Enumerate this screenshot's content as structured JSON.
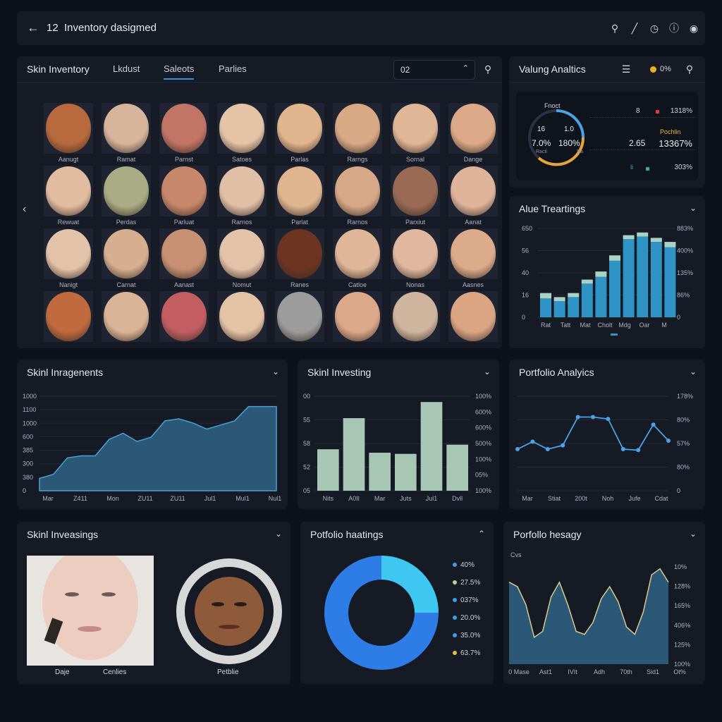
{
  "header": {
    "title": "12  Inventory dasigmed"
  },
  "skin_inventory": {
    "title": "Skin Inventory",
    "tabs": [
      "Lkdust",
      "Saleots",
      "Parlies"
    ],
    "search_value": "02",
    "faces": [
      {
        "label": "Aanugt",
        "color": "#b86a3e"
      },
      {
        "label": "Ramat",
        "color": "#d7b49c"
      },
      {
        "label": "Parnst",
        "color": "#c27466"
      },
      {
        "label": "Satoes",
        "color": "#e4c3a6"
      },
      {
        "label": "Parlas",
        "color": "#e1b58e"
      },
      {
        "label": "Rarngs",
        "color": "#d9a986"
      },
      {
        "label": "Sornal",
        "color": "#e0b796"
      },
      {
        "label": "Dange",
        "color": "#dcaa88"
      },
      {
        "label": "Rewuat",
        "color": "#e2bca0"
      },
      {
        "label": "Perdas",
        "color": "#a9ac84"
      },
      {
        "label": "Parluat",
        "color": "#c7876a"
      },
      {
        "label": "Rarnos",
        "color": "#e1bfa6"
      },
      {
        "label": "Parlat",
        "color": "#dfb590"
      },
      {
        "label": "Rarnos",
        "color": "#d7a888"
      },
      {
        "label": "Parxiut",
        "color": "#9a6a55"
      },
      {
        "label": "Aanat",
        "color": "#e0b49a"
      },
      {
        "label": "Nanigt",
        "color": "#e2c2a8"
      },
      {
        "label": "Carnat",
        "color": "#d6ae90"
      },
      {
        "label": "Aanast",
        "color": "#c79072"
      },
      {
        "label": "Nomut",
        "color": "#e2c2a8"
      },
      {
        "label": "Ranes",
        "color": "#6e3422"
      },
      {
        "label": "Catloe",
        "color": "#dfb698"
      },
      {
        "label": "Nonas",
        "color": "#e0b8a0"
      },
      {
        "label": "Aasnes",
        "color": "#dcab8c"
      },
      {
        "label": "",
        "color": "#c06a3e"
      },
      {
        "label": "",
        "color": "#d9b496"
      },
      {
        "label": "",
        "color": "#c25e62"
      },
      {
        "label": "",
        "color": "#e4c2a6"
      },
      {
        "label": "",
        "color": "#9c9c9c"
      },
      {
        "label": "",
        "color": "#dba888"
      },
      {
        "label": "",
        "color": "#cfb59e"
      },
      {
        "label": "",
        "color": "#dba584"
      }
    ]
  },
  "valuing": {
    "title": "Valung Analtics",
    "status_text": "0%",
    "gauge": {
      "top": "Fnoct",
      "left_top": "16",
      "left_val": "7.0%",
      "left_sub": "Racti",
      "right_top": "1.0",
      "right_val": "180%",
      "right_sub": "Ra"
    },
    "rows": [
      {
        "a": "8",
        "b": "1318%"
      },
      {
        "a": "Pochlin",
        "b": ""
      },
      {
        "a": "2.65",
        "b": "13367%"
      },
      {
        "a": "li",
        "b": "303%"
      }
    ]
  },
  "alue": {
    "title": "Alue Treartings",
    "chart_data": {
      "type": "bar",
      "categories": [
        "Rat",
        "Tatt",
        "Mat",
        "Cholt",
        "Mdg",
        "Oar",
        "M"
      ],
      "series": [
        {
          "name": "",
          "values": [
            14,
            12,
            15,
            25,
            30,
            42,
            58,
            60,
            56,
            52
          ]
        },
        {
          "name": "",
          "values": [
            4,
            3,
            3,
            3,
            4,
            4,
            3,
            3,
            3,
            4
          ]
        }
      ],
      "y_left_ticks": [
        "650",
        "56",
        "40",
        "16",
        "0"
      ],
      "y_right_ticks": [
        "883%",
        "400%",
        "135%",
        "86%",
        "0"
      ]
    }
  },
  "skin_img": {
    "title": "Skinl Inragenents",
    "chart_data": {
      "type": "area",
      "values": [
        6,
        8,
        16,
        17,
        17,
        25,
        28,
        24,
        26,
        34,
        35,
        33,
        30,
        32,
        34,
        41,
        41,
        41
      ],
      "y_ticks": [
        "1000",
        "1100",
        "1000",
        "600",
        "385",
        "300",
        "380",
        "0"
      ],
      "x_ticks": [
        "Mar",
        "Z411",
        "Mon",
        "ZU11",
        "ZU11",
        "Jul1",
        "Mul1",
        "Nul1"
      ]
    }
  },
  "skin_invest": {
    "title": "Skinl Investing",
    "chart_data": {
      "type": "bar",
      "values": [
        36,
        63,
        33,
        32,
        77,
        40
      ],
      "y_left_ticks": [
        "00",
        "55",
        "58",
        "52",
        "05"
      ],
      "y_right_ticks": [
        "100%",
        "600%",
        "600%",
        "500%",
        "100%",
        "05%",
        "100%"
      ],
      "x_ticks": [
        "Nits",
        "A0Il",
        "Mar",
        "Juts",
        "Jul1",
        "Dvll"
      ]
    }
  },
  "portfolio_analytics": {
    "title": "Portfolio Analyics",
    "chart_data": {
      "type": "line",
      "values": [
        44,
        52,
        44,
        48,
        78,
        78,
        76,
        44,
        43,
        70,
        53
      ],
      "y_ticks": [
        "178%",
        "80%",
        "57%",
        "80%",
        "0"
      ],
      "x_ticks": [
        "Mar",
        "Stiat",
        "200t",
        "Noh",
        "Jufe",
        "Cdat"
      ]
    }
  },
  "skin_investings": {
    "title": "Skinl Inveasings",
    "labels": [
      "Daje",
      "Cenlies",
      "Petblie"
    ]
  },
  "portfolio_holdings": {
    "title": "Potfolio haatings",
    "chart_data": {
      "type": "pie",
      "slices": [
        75,
        25
      ],
      "colors": [
        "#2e7ce6",
        "#3ec7f0"
      ],
      "legend": [
        "40%",
        "27.5%",
        "037%",
        "20.0%",
        "35.0%",
        "63.7%"
      ],
      "legend_colors": [
        "#3aa0e8",
        "#b7d28c",
        "#3aa0e8",
        "#3aa0e8",
        "#3aa0e8",
        "#e6b94a"
      ]
    }
  },
  "portfolio_hesagy": {
    "title": "Porfollo hesagy",
    "top_label": "Cvs",
    "chart_data": {
      "type": "area",
      "values": [
        55,
        52,
        40,
        18,
        22,
        45,
        55,
        40,
        22,
        20,
        28,
        44,
        52,
        42,
        25,
        20,
        35,
        60,
        64,
        55
      ],
      "y_ticks": [
        "10%",
        "128%",
        "165%",
        "406%",
        "125%",
        "100%"
      ],
      "x_ticks": [
        "0 Mase",
        "Ast1",
        "IVIt",
        "Adh",
        "70th",
        "Sid1",
        "Ot%"
      ]
    }
  }
}
